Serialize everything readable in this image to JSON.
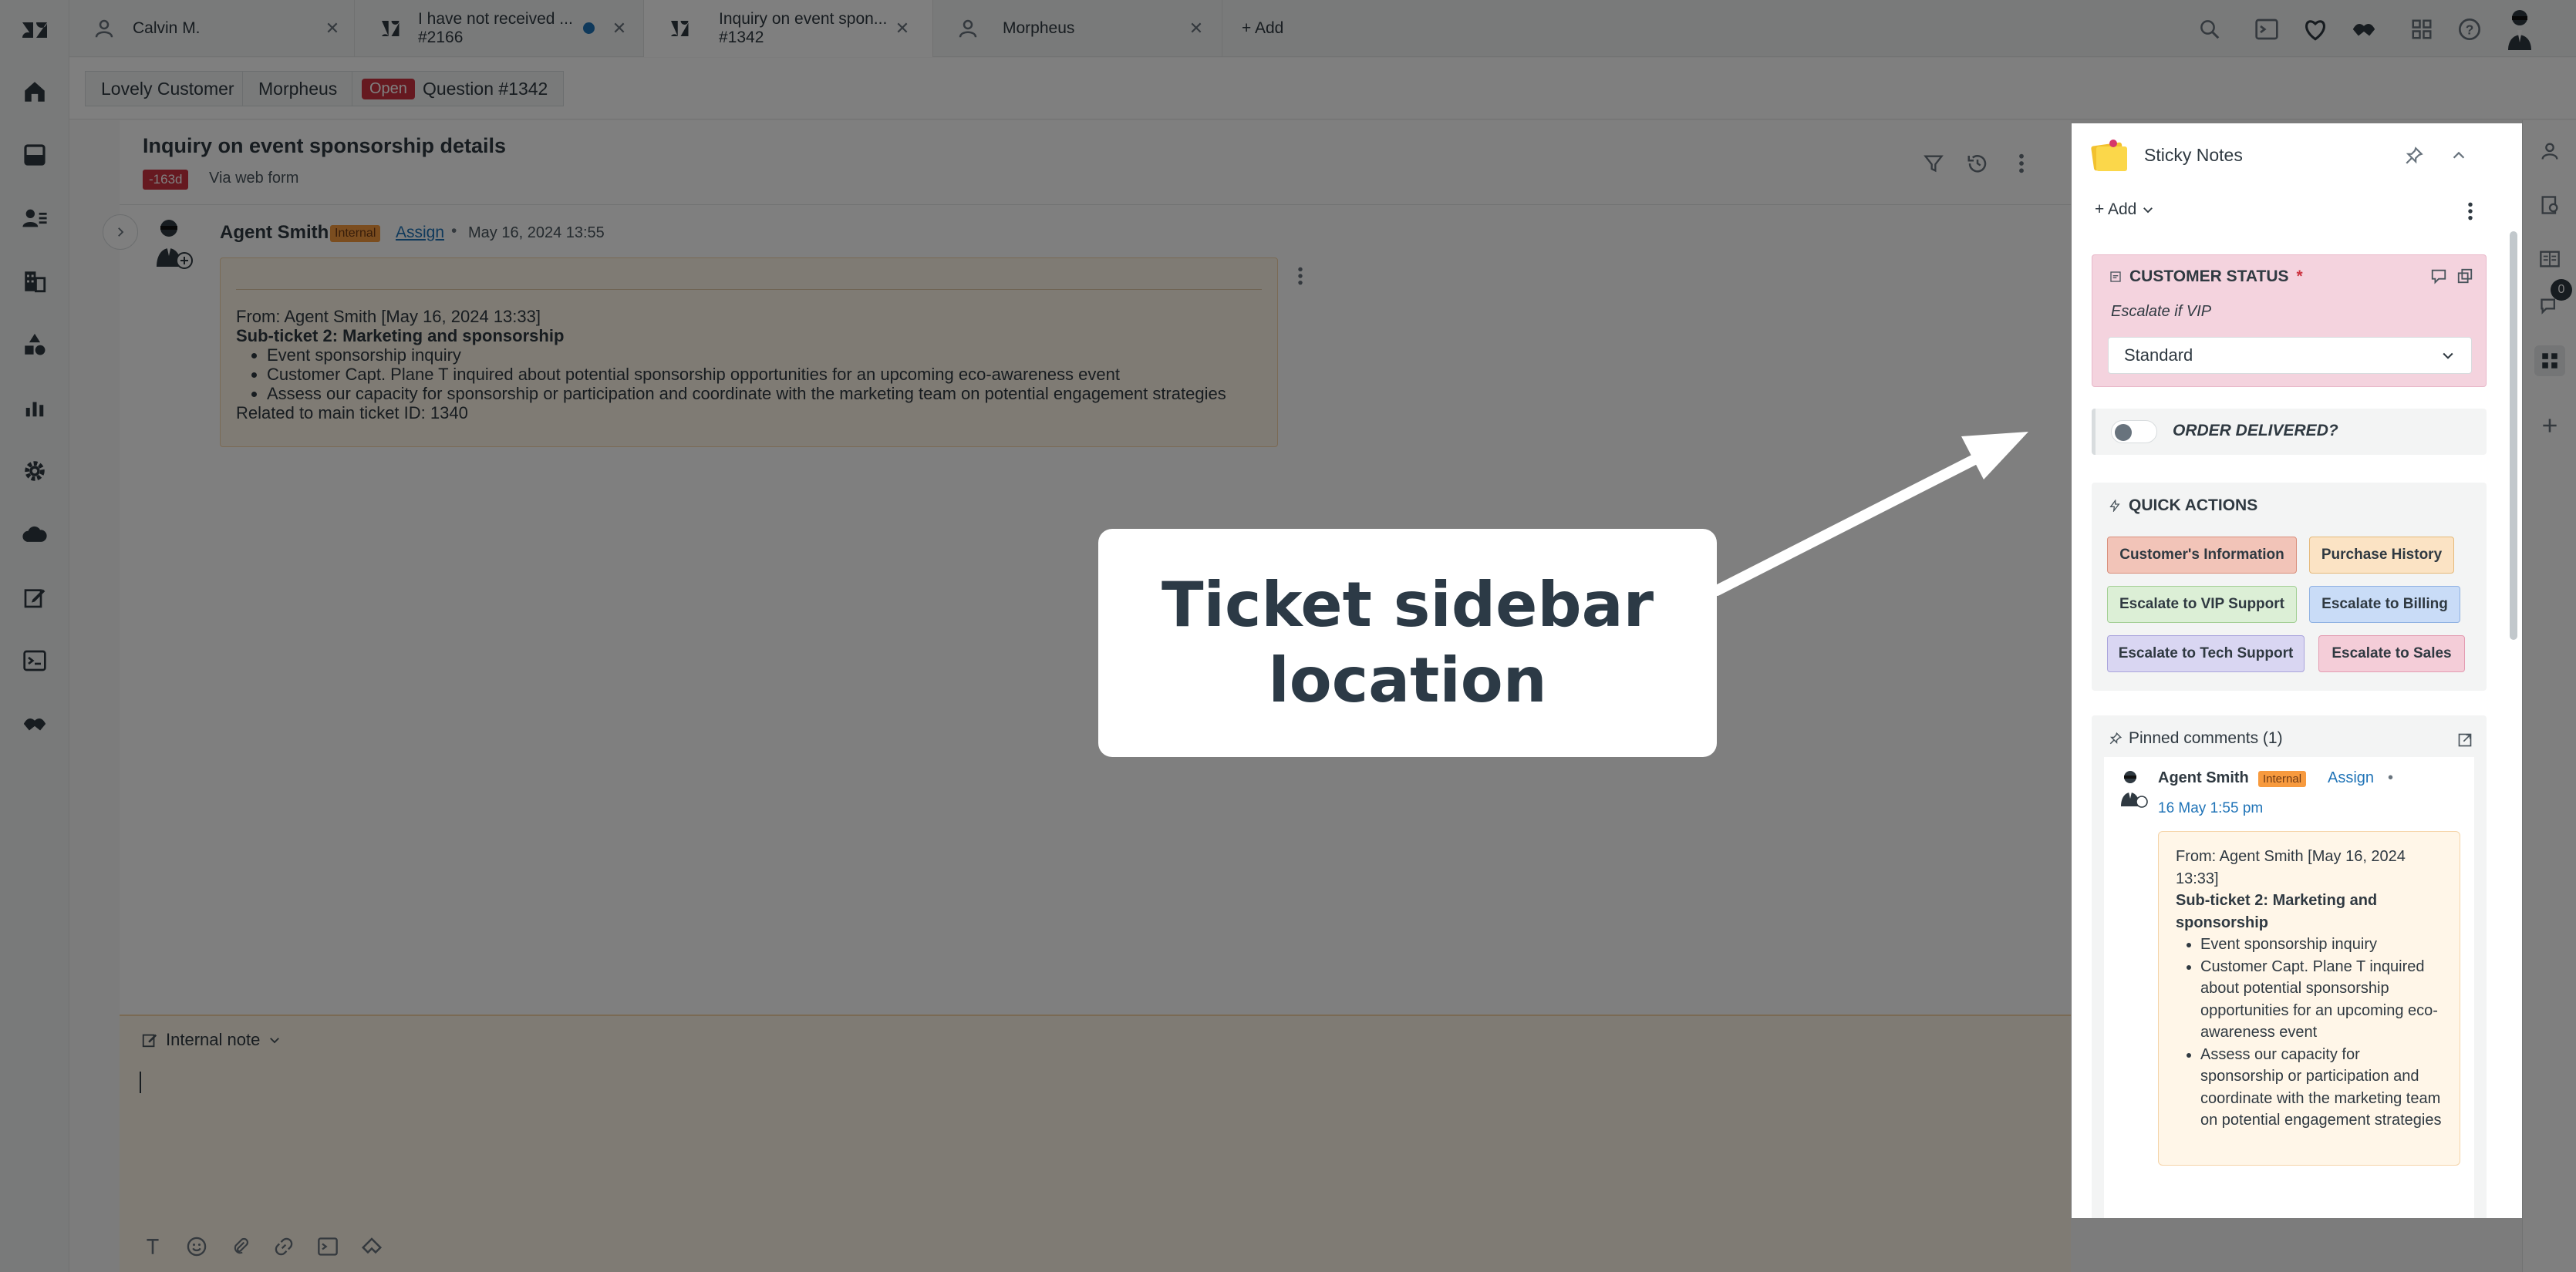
{
  "top_tabs": [
    {
      "title": "Calvin M.",
      "subtitle": "",
      "icon": "user-icon"
    },
    {
      "title": "I have not received ...",
      "subtitle": "#2166",
      "icon": "ticket-icon"
    },
    {
      "title": "Inquiry on event spon...",
      "subtitle": "#1342",
      "icon": "ticket-icon"
    },
    {
      "title": "Morpheus",
      "subtitle": "",
      "icon": "user-icon"
    }
  ],
  "add_tab_label": "+ Add",
  "breadcrumb": {
    "customer": "Lovely Customer",
    "agent": "Morpheus",
    "status": "Open",
    "ticket": "Question #1342"
  },
  "ticket": {
    "title": "Inquiry on event sponsorship details",
    "age_badge": "-163d",
    "via": "Via web form"
  },
  "comment": {
    "author": "Agent Smith",
    "badge": "Internal",
    "assign_label": "Assign",
    "separator": "•",
    "date": "May 16, 2024 13:55",
    "from_line": "From: Agent Smith [May 16, 2024 13:33]",
    "subject": "Sub-ticket 2: Marketing and sponsorship",
    "bullets": [
      "Event sponsorship inquiry",
      "Customer Capt. Plane T inquired about potential sponsorship opportunities for an upcoming eco-awareness event",
      "Assess our capacity for sponsorship or participation and coordinate with the marketing team on potential engagement strategies"
    ],
    "related": "Related to main ticket ID: 1340"
  },
  "composer": {
    "mode_label": "Internal note"
  },
  "rail": {
    "badge_count": "0"
  },
  "sticky_notes": {
    "title": "Sticky Notes",
    "add_label": "+ Add",
    "customer_status": {
      "heading": "CUSTOMER STATUS",
      "required_mark": "*",
      "hint": "Escalate if VIP",
      "selected": "Standard"
    },
    "order_delivered": {
      "label": "ORDER DELIVERED?",
      "on": false
    },
    "quick_actions": {
      "heading": "QUICK ACTIONS",
      "buttons": [
        {
          "label": "Customer's Information",
          "color": "#f2c4b8"
        },
        {
          "label": "Purchase History",
          "color": "#fbe3c4"
        },
        {
          "label": "Escalate to VIP Support",
          "color": "#dcefd6"
        },
        {
          "label": "Escalate to Billing",
          "color": "#c9dcf7"
        },
        {
          "label": "Escalate to Tech Support",
          "color": "#d9d6f2"
        },
        {
          "label": "Escalate to Sales",
          "color": "#f4cdd8"
        }
      ]
    },
    "pinned": {
      "heading": "Pinned comments (1)",
      "author": "Agent Smith",
      "badge": "Internal",
      "assign_label": "Assign",
      "separator": "•",
      "date": "16 May 1:55 pm",
      "from_line": "From: Agent Smith [May 16, 2024 13:33]",
      "subject": "Sub-ticket 2: Marketing and sponsorship",
      "bullets": [
        "Event sponsorship inquiry",
        "Customer Capt. Plane T inquired about potential sponsorship opportunities for an upcoming eco-awareness event",
        "Assess our capacity for sponsorship or participation and coordinate with the marketing team on potential engagement strategies"
      ]
    }
  },
  "callout": {
    "line1": "Ticket sidebar",
    "line2": "location"
  },
  "colors": {
    "danger": "#cc3340",
    "link": "#1f73b7",
    "internal_badge": "#f79a3e",
    "note_bg": "#fff6e8",
    "status_card": "#f4d3de"
  }
}
